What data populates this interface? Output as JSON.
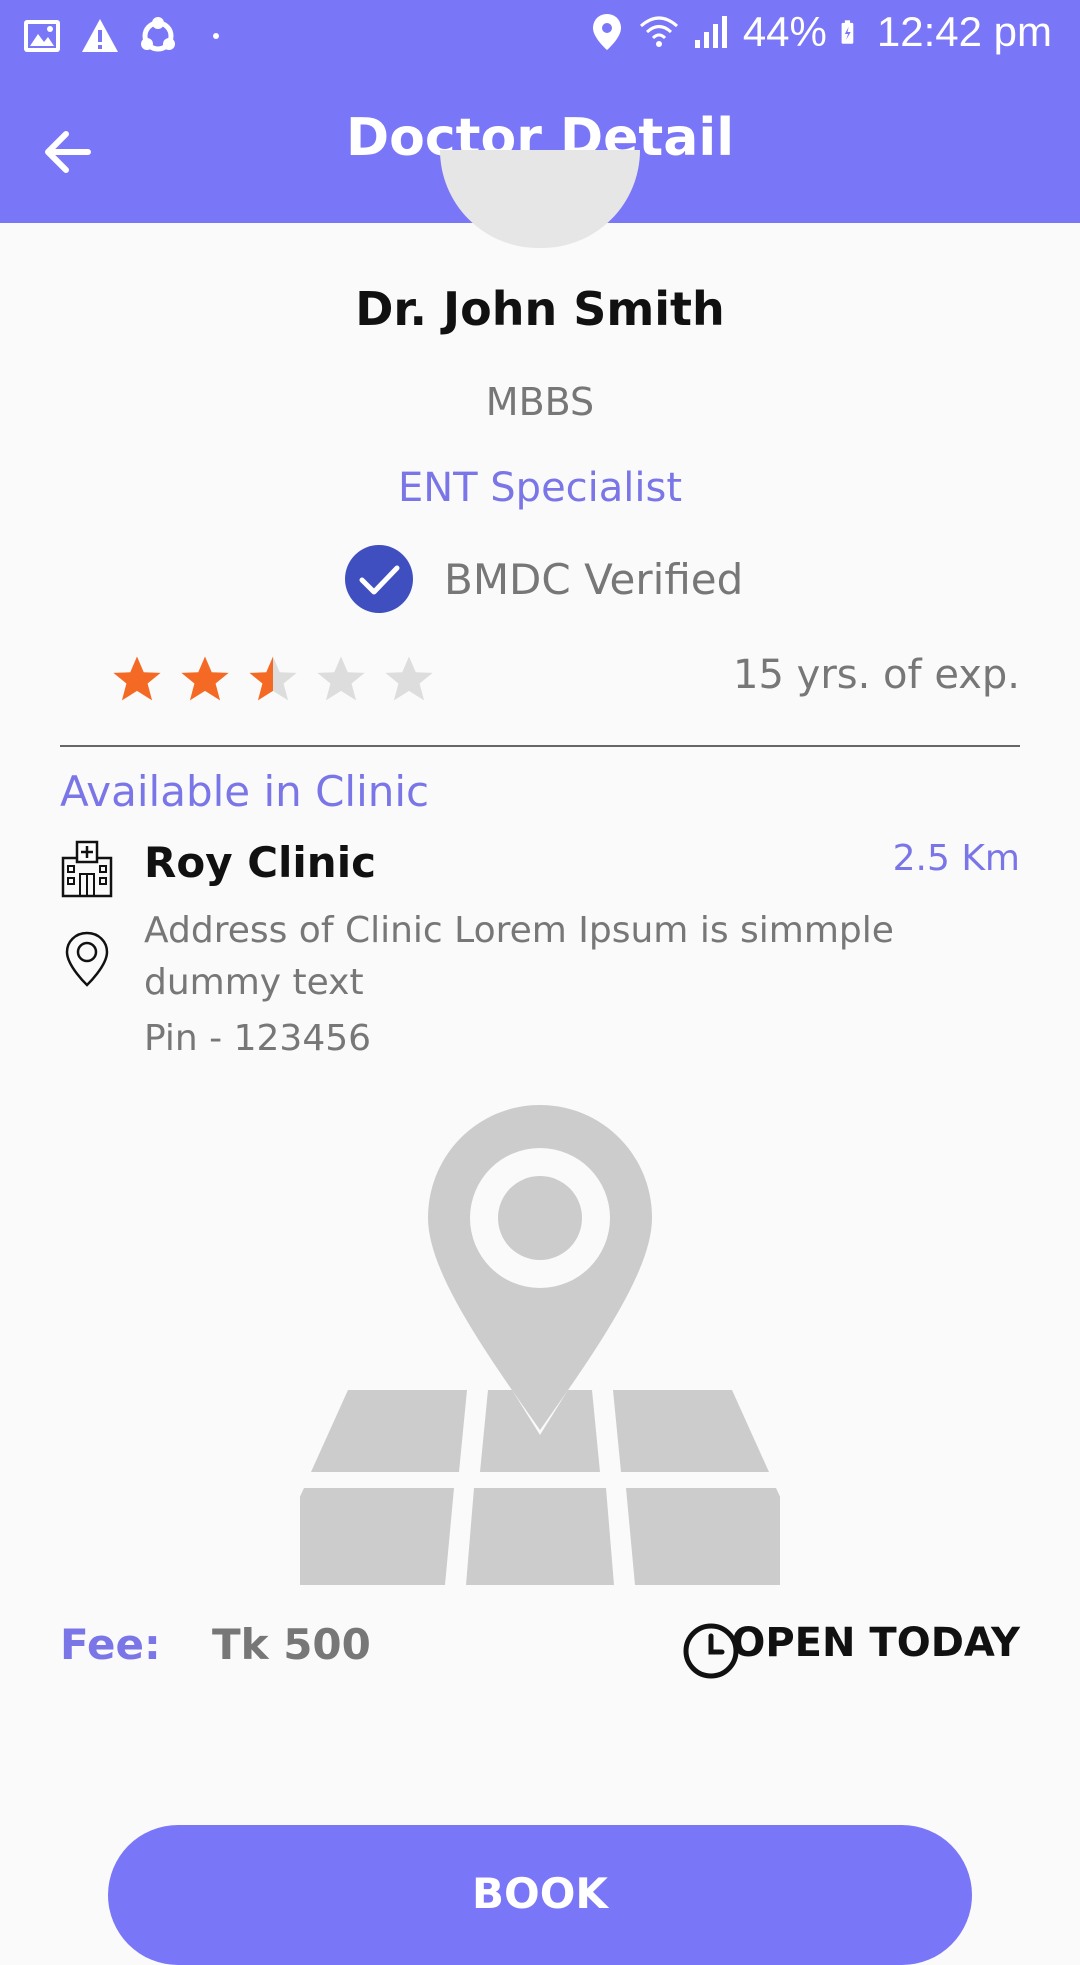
{
  "status_bar": {
    "battery": "44%",
    "time": "12:42 pm",
    "icons": [
      "gallery-icon",
      "warning-icon",
      "share-app-icon",
      "dot-icon",
      "location-icon",
      "wifi-icon",
      "signal-icon",
      "battery-icon"
    ]
  },
  "app_bar": {
    "title": "Doctor Detail",
    "back_icon": "arrow-left-icon"
  },
  "doctor": {
    "name": "Dr. John Smith",
    "degree": "MBBS",
    "specialty": "ENT Specialist",
    "verified_label": "BMDC Verified",
    "rating": 2.5,
    "rating_max": 5,
    "experience": "15 yrs. of exp."
  },
  "clinic": {
    "section_title": "Available in Clinic",
    "name": "Roy Clinic",
    "distance": "2.5 Km",
    "address": "Address of Clinic Lorem Ipsum is simmple dummy text",
    "pin": "Pin - 123456"
  },
  "fee": {
    "label": "Fee:",
    "value": "Tk 500"
  },
  "schedule": {
    "status": "OPEN TODAY"
  },
  "book_button": {
    "label": "BOOK"
  },
  "colors": {
    "primary": "#7a76f8",
    "accent_text": "#7a76e8",
    "verified_badge": "#3f4fc0",
    "star_filled": "#f46a25",
    "star_empty": "#dddddd",
    "illustration": "#cccccc"
  }
}
